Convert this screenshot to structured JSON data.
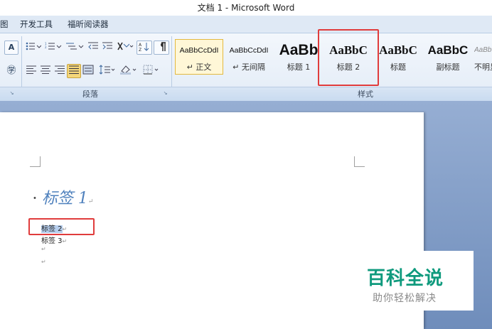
{
  "window": {
    "title": "文档 1 - Microsoft Word"
  },
  "tabs": [
    {
      "label": "图"
    },
    {
      "label": "开发工具"
    },
    {
      "label": "福昕阅读器"
    }
  ],
  "ribbon": {
    "font_group": {
      "big_a": "A",
      "circled_a": "㊫"
    },
    "paragraph_group": {
      "label": "段落"
    },
    "styles_group": {
      "label": "样式",
      "items": [
        {
          "preview": "AaBbCcDdI",
          "name": "↵ 正文"
        },
        {
          "preview": "AaBbCcDdI",
          "name": "↵ 无间隔"
        },
        {
          "preview": "AaBb",
          "name": "标题 1"
        },
        {
          "preview": "AaBbC",
          "name": "标题 2"
        },
        {
          "preview": "AaBbC",
          "name": "标题"
        },
        {
          "preview": "AaBbC",
          "name": "副标题"
        },
        {
          "preview": "AaBb",
          "name": "不明显"
        }
      ]
    }
  },
  "document": {
    "lines": [
      {
        "text": "标签 1",
        "mark": "↵"
      },
      {
        "text": "标签 2",
        "mark": "↵"
      },
      {
        "text": "标签 3",
        "mark": "↵"
      },
      {
        "text": "",
        "mark": "↵"
      },
      {
        "text": "",
        "mark": "↵"
      }
    ]
  },
  "watermark": {
    "title": "百科全说",
    "subtitle": "助你轻松解决"
  },
  "colors": {
    "highlight": "#e03c3c",
    "heading_blue": "#4f81bd",
    "ribbon_bg": "#e3ecf7",
    "canvas_bg": "#7f9cc7"
  }
}
